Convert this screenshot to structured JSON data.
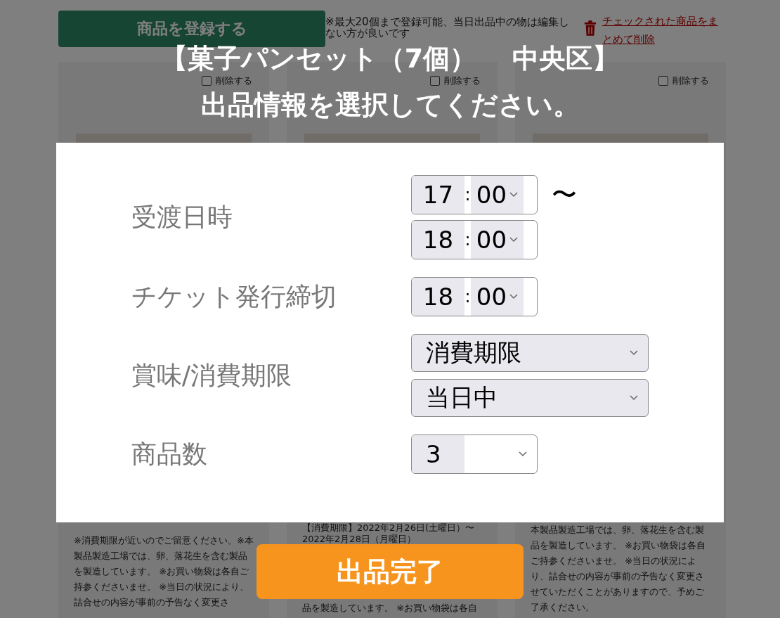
{
  "page": {
    "register_button": "商品を登録する",
    "note": "※最大20個まで登録可能、当日出品中の物は編集しない方が良いです",
    "bulk_delete_link": "チェックされた商品をまとめて削除",
    "cards": [
      {
        "delete_label": "削除する",
        "delete_checked": false,
        "texts": [
          "※消費期限が近いのでご留意ください。※本製品製造工場では、卵、落花生を含む製品を製造しています。 ※お買い物袋は各自ご持参くださいませ。 ※当日の状況により、詰合せの内容が事前の予告なく変更さ"
        ]
      },
      {
        "delete_label": "削除する",
        "delete_checked": false,
        "texts": [
          "【消費期限】2022年2月26日(土曜日）〜2022年2月28日（月曜日）",
          "品を製造しています。 ※お買い物袋は各自"
        ]
      },
      {
        "delete_label": "削除する",
        "delete_checked": false,
        "texts": [
          "本製品製造工場では、卵、落花生を含む製品を製造しています。 ※お買い物袋は各自ご持参くださいませ。 ※当日の状況により、詰合せの内容が事前の予告なく変更させていただくことがありますので、予めご了承ください。"
        ]
      }
    ]
  },
  "modal": {
    "title": "【菓子パンセット（7個）　 中央区】",
    "subtitle": "出品情報を選択してください。",
    "rows": [
      {
        "kind": "time_range",
        "label": "受渡日時",
        "times": [
          {
            "hour": "17",
            "colon": ":",
            "minute": "00"
          },
          {
            "hour": "18",
            "colon": ":",
            "minute": "00"
          }
        ],
        "separator": "〜"
      },
      {
        "kind": "time",
        "label": "チケット発行締切",
        "times": [
          {
            "hour": "18",
            "colon": ":",
            "minute": "00"
          }
        ]
      },
      {
        "kind": "selects",
        "label": "賞味/消費期限",
        "values": [
          "消費期限",
          "当日中"
        ]
      },
      {
        "kind": "number",
        "label": "商品数",
        "value": "3"
      }
    ],
    "submit_button": "出品完了"
  }
}
